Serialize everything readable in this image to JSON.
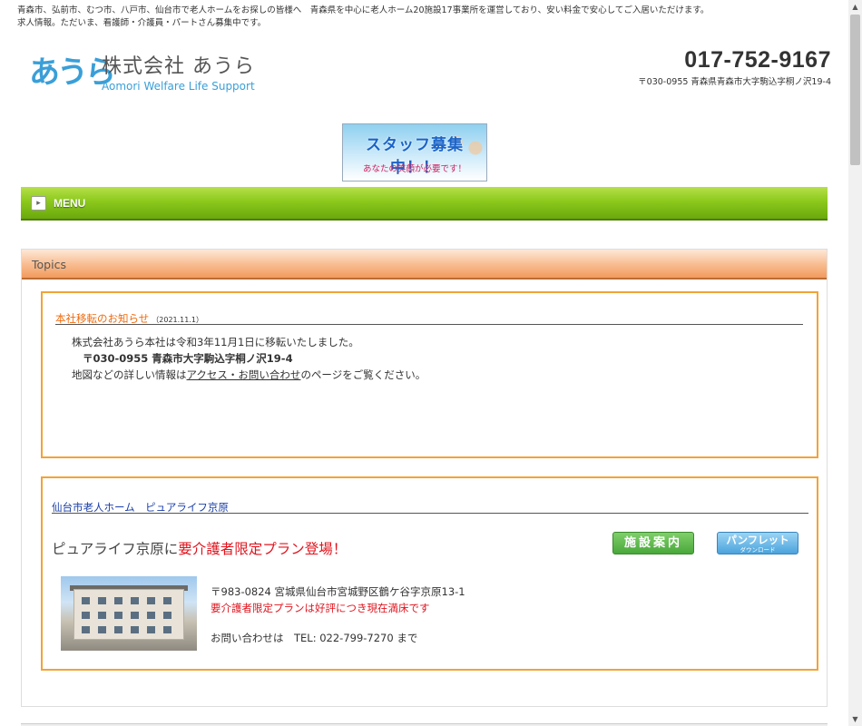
{
  "header": {
    "top_line1": "青森市、弘前市、むつ市、八戸市、仙台市で老人ホームをお探しの皆様へ　青森県を中心に老人ホーム20施設17事業所を運営しており、安い料金で安心してご入居いただけます。",
    "top_line2": "求人情報。ただいま、看護師・介護員・パートさん募集中です。",
    "logo_mark": "あうら",
    "company_name": "株式会社 あうら",
    "company_sub": "Aomori Welfare Life Support",
    "phone": "017-752-9167",
    "address": "〒030-0955 青森県青森市大字駒込字桐ノ沢19-4"
  },
  "banner": {
    "title": "スタッフ募集中！！",
    "subtitle": "あなたの笑顔が必要です！"
  },
  "menu": {
    "label": "MENU",
    "icon": "arrow-right-icon"
  },
  "topics": {
    "label": "Topics",
    "news": {
      "title": "本社移転のお知らせ",
      "date": "（2021.11.1）",
      "line1": "株式会社あうら本社は令和3年11月1日に移転いたしました。",
      "line2": "〒030-0955 青森市大字駒込字桐ノ沢19-4",
      "line3_prefix": "地図などの詳しい情報は",
      "line3_link": "アクセス・お問い合わせ",
      "line3_suffix": "のページをご覧ください。"
    },
    "facility": {
      "title": "仙台市老人ホーム　ピュアライフ京原",
      "headline_prefix": "ピュアライフ京原に",
      "headline_red": "要介護者限定プラン登場！",
      "guide_button": "施設案内",
      "pamphlet_button": "パンフレット",
      "pamphlet_sub": "ダウンロード",
      "address": "〒983-0824 宮城県仙台市宮城野区鶴ケ谷字京原13-1",
      "status": "要介護者限定プランは好評につき現在満床です",
      "contact": "お問い合わせは　TEL: 022-799-7270 まで"
    }
  },
  "colors": {
    "menu_green": "#8cc91c",
    "topics_orange": "#f29a5e",
    "box_border": "#f2a336",
    "accent_red": "#e0141e",
    "link_blue": "#1a3fa8",
    "logo_blue": "#3a9fd8"
  }
}
